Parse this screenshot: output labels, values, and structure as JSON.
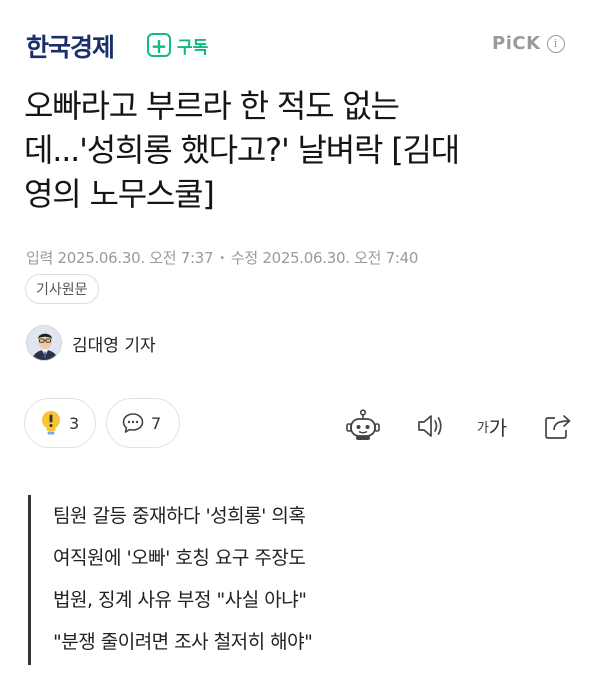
{
  "header": {
    "logo": "한국경제",
    "subscribe_icon": "+",
    "subscribe_label": "구독",
    "pick_label": "PiCK",
    "info_icon": "i"
  },
  "article": {
    "headline_lines": [
      "오빠라고 부르라 한 적도 없는",
      "데...'성희롱 했다고?' 날벼락 [김대",
      "영의 노무스쿨]"
    ],
    "published": "입력 2025.06.30. 오전 7:37",
    "modified": "수정 2025.06.30. 오전 7:40",
    "original_button": "기사원문",
    "reporter": "김대영 기자"
  },
  "reactions": {
    "like_count": "3",
    "comment_count": "7"
  },
  "tools": {
    "font_small": "가",
    "font_large": "가"
  },
  "summary": [
    "팀원 갈등 중재하다 '성희롱' 의혹",
    "여직원에 '오빠' 호칭 요구 주장도",
    "법원, 징계 사유 부정 \"사실 아냐\"",
    "\"분쟁 줄이려면 조사 철저히 해야\""
  ],
  "colors": {
    "brand": "#1b2f6b",
    "subscribe": "#12b886",
    "meta": "#9a9a9a",
    "like_icon": "#f6c531"
  },
  "icons": [
    "plus-icon",
    "info-icon",
    "lightbulb-icon",
    "comment-icon",
    "robot-icon",
    "speaker-icon",
    "share-icon"
  ]
}
